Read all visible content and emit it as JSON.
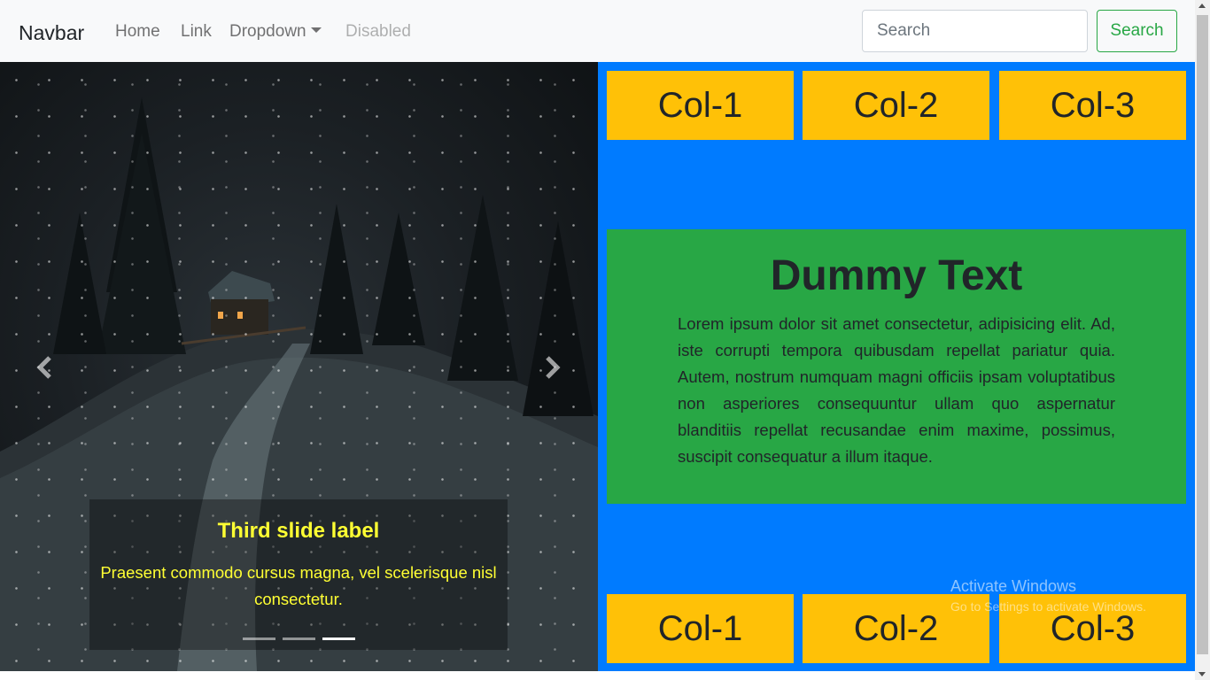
{
  "navbar": {
    "brand": "Navbar",
    "links": [
      {
        "label": "Home"
      },
      {
        "label": "Link"
      },
      {
        "label": "Dropdown"
      },
      {
        "label": "Disabled"
      }
    ],
    "search": {
      "placeholder": "Search",
      "button_label": "Search"
    }
  },
  "carousel": {
    "caption_title": "Third slide label",
    "caption_text": "Praesent commodo cursus magna, vel scelerisque nisl consectetur.",
    "slides_total": 3,
    "active_slide": 3
  },
  "grid": {
    "top_row": [
      "Col-1",
      "Col-2",
      "Col-3"
    ],
    "bottom_row": [
      "Col-1",
      "Col-2",
      "Col-3"
    ]
  },
  "feature": {
    "title": "Dummy Text",
    "body": "Lorem ipsum dolor sit amet consectetur, adipisicing elit. Ad, iste corrupti tempora quibusdam repellat pariatur quia. Autem, nostrum numquam magni officiis ipsam voluptatibus non asperiores consequuntur ullam quo aspernatur blanditiis repellat recusandae enim maxime, possimus, suscipit consequatur a illum itaque."
  },
  "watermark": {
    "line1": "Activate Windows",
    "line2": "Go to Settings to activate Windows."
  },
  "colors": {
    "navbar_bg": "#f8f9fa",
    "panel_bg": "#007bff",
    "col_bg": "#ffc107",
    "feature_bg": "#28a745",
    "caption_text": "#ffff33",
    "search_button": "#28a745"
  }
}
